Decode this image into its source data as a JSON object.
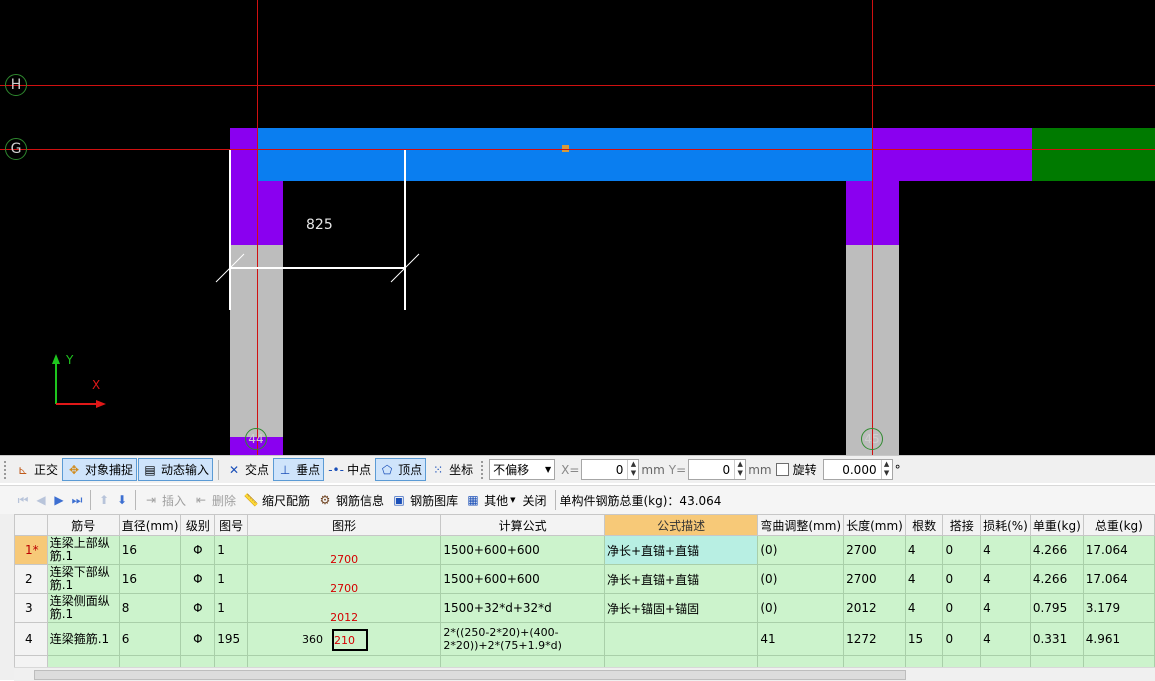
{
  "canvas": {
    "axes": [
      {
        "id": "H"
      },
      {
        "id": "G"
      },
      {
        "id": "44"
      },
      {
        "id": "45"
      }
    ],
    "dimension": "825",
    "ucs": {
      "x_label": "X",
      "y_label": "Y"
    }
  },
  "toolbar_top": {
    "ortho": "正交",
    "snap": "对象捕捉",
    "dynamic_input": "动态输入",
    "intersection": "交点",
    "perpendicular": "垂点",
    "midpoint": "中点",
    "vertex": "顶点",
    "coordinate": "坐标",
    "offset_mode": "不偏移",
    "x_label": "X=",
    "x_value": "0",
    "y_label": "Y=",
    "y_value": "0",
    "unit": "mm",
    "rotate": "旋转",
    "rotate_value": "0.000",
    "degree": "°"
  },
  "toolbar_rebar": {
    "insert": "插入",
    "delete": "删除",
    "scale_rebar": "缩尺配筋",
    "rebar_info": "钢筋信息",
    "rebar_library": "钢筋图库",
    "other": "其他",
    "close": "关闭",
    "total_weight": "单构件钢筋总重(kg)：43.064"
  },
  "table": {
    "headers": [
      "",
      "筋号",
      "直径(mm)",
      "级别",
      "图号",
      "图形",
      "计算公式",
      "公式描述",
      "弯曲调整(mm)",
      "长度(mm)",
      "根数",
      "搭接",
      "损耗(%)",
      "单重(kg)",
      "总重(kg)"
    ],
    "rows": [
      {
        "idx": "1*",
        "name": "连梁上部纵筋.1",
        "dia": "16",
        "grade": "Φ",
        "fig": "1",
        "shape": "2700",
        "formula": "1500+600+600",
        "desc": "净长+直锚+直锚",
        "bend": "(0)",
        "len": "2700",
        "count": "4",
        "lap": "0",
        "loss": "4",
        "unit_w": "4.266",
        "total_w": "17.064"
      },
      {
        "idx": "2",
        "name": "连梁下部纵筋.1",
        "dia": "16",
        "grade": "Φ",
        "fig": "1",
        "shape": "2700",
        "formula": "1500+600+600",
        "desc": "净长+直锚+直锚",
        "bend": "(0)",
        "len": "2700",
        "count": "4",
        "lap": "0",
        "loss": "4",
        "unit_w": "4.266",
        "total_w": "17.064"
      },
      {
        "idx": "3",
        "name": "连梁侧面纵筋.1",
        "dia": "8",
        "grade": "Φ",
        "fig": "1",
        "shape": "2012",
        "formula": "1500+32*d+32*d",
        "desc": "净长+锚固+锚固",
        "bend": "(0)",
        "len": "2012",
        "count": "4",
        "lap": "0",
        "loss": "4",
        "unit_w": "0.795",
        "total_w": "3.179"
      },
      {
        "idx": "4",
        "name": "连梁箍筋.1",
        "dia": "6",
        "grade": "Φ",
        "fig": "195",
        "shape_a": "360",
        "shape_b": "210",
        "formula": "2*((250-2*20)+(400-2*20))+2*(75+1.9*d)",
        "desc": "",
        "bend": "41",
        "len": "1272",
        "count": "15",
        "lap": "0",
        "loss": "4",
        "unit_w": "0.331",
        "total_w": "4.961"
      }
    ]
  },
  "colors": {
    "beam_blue": "#0a7ef0",
    "column_purple": "#8a00f0",
    "wall_green": "#007a00",
    "column_grey": "#bdbdbd",
    "axis_red": "#d01010",
    "row_green": "#ccf3cc",
    "header_orange": "#f7c978"
  }
}
